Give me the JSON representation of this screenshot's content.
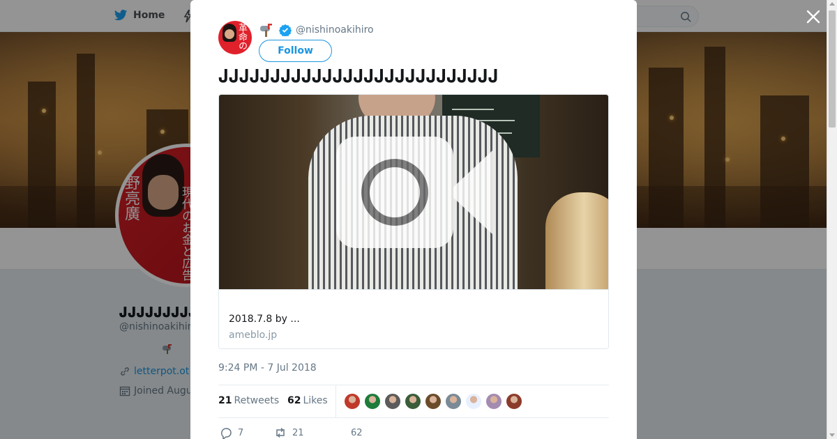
{
  "nav": {
    "home_label": "Home"
  },
  "profile": {
    "name_display": "𝐉𝐉𝐉𝐉𝐉𝐉𝐉𝐉𝐉𝐉",
    "handle": "@nishinoakihiro",
    "link_text": "letterpot.ot",
    "joined_text": "Joined Augu",
    "avatar_text_left": "野亮廣",
    "avatar_text_right": "現代のお金と広告"
  },
  "tweet": {
    "avatar_glyph": "革命の",
    "handle": "@nishinoakihiro",
    "follow_label": "Follow",
    "text": "𝐉𝐉𝐉𝐉𝐉𝐉𝐉𝐉𝐉𝐉𝐉𝐉𝐉𝐉𝐉𝐉𝐉𝐉𝐉𝐉𝐉𝐉𝐉𝐉𝐉𝐉𝐉",
    "card": {
      "title": "2018.7.8 by ...",
      "domain": "ameblo.jp"
    },
    "timestamp": "9:24 PM - 7 Jul 2018",
    "retweets_count": "21",
    "retweets_label": "Retweets",
    "likes_count": "62",
    "likes_label": "Likes",
    "liker_colors": [
      "#c0392b",
      "#1e7b3a",
      "#5b5b5b",
      "#3b5d3a",
      "#6b4c2a",
      "#7a8a96",
      "#e8f0ff",
      "#a48bb0",
      "#8c3b2b"
    ],
    "actions": {
      "reply_count": "7",
      "retweet_count": "21",
      "like_count": "62"
    }
  },
  "colors": {
    "accent": "#1b95e0",
    "verified": "#1da1f2",
    "muted": "#657786"
  }
}
